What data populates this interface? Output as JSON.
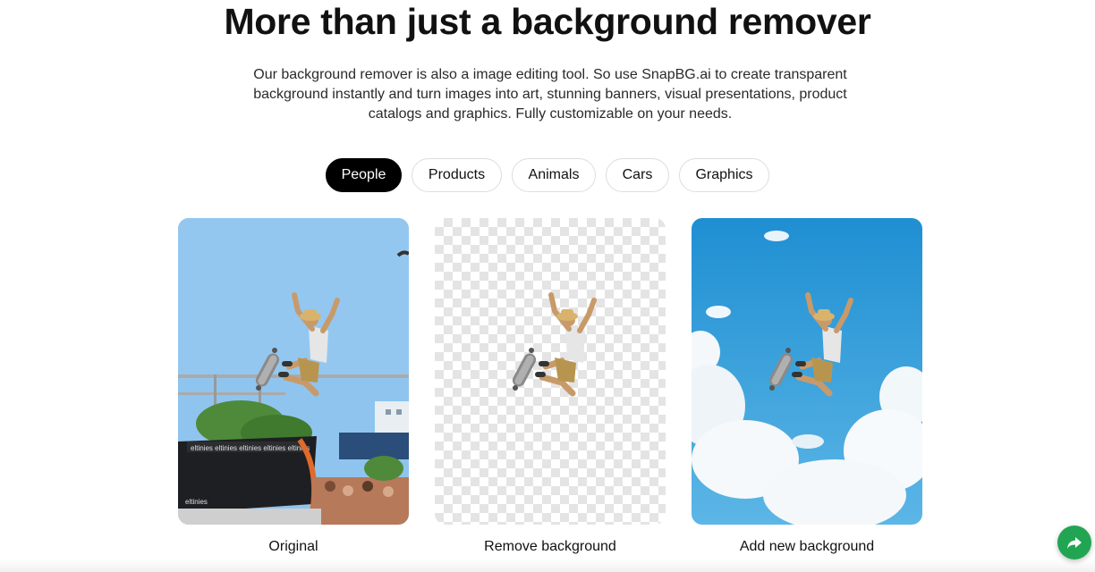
{
  "header": {
    "title": "More than just a background remover",
    "description": "Our background remover is also a image editing tool. So use SnapBG.ai to create transparent background instantly and turn images into art, stunning banners, visual presentations, product catalogs and graphics. Fully customizable on your needs."
  },
  "tabs": [
    {
      "label": "People",
      "active": true
    },
    {
      "label": "Products",
      "active": false
    },
    {
      "label": "Animals",
      "active": false
    },
    {
      "label": "Cars",
      "active": false
    },
    {
      "label": "Graphics",
      "active": false
    }
  ],
  "examples": [
    {
      "caption": "Original",
      "image": "skateboarder-original-photo"
    },
    {
      "caption": "Remove background",
      "image": "skateboarder-transparent-background"
    },
    {
      "caption": "Add new background",
      "image": "skateboarder-sky-background"
    }
  ],
  "banner_text": {
    "ramp_top": "eltinies eltinies eltinies eltinies eltinies",
    "ramp_bottom": "eltinies"
  },
  "icons": {
    "share": "share-arrow-icon"
  },
  "colors": {
    "active_tab": "#000000",
    "share_button": "#22a552",
    "sky_original": "#8fc4ee",
    "sky_new": "#2f9fdb"
  }
}
